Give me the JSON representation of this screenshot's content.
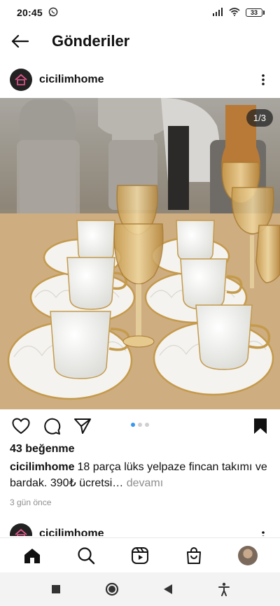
{
  "status_bar": {
    "time": "20:45",
    "battery": "33"
  },
  "header": {
    "title": "Gönderiler"
  },
  "post": {
    "username": "cicilimhome",
    "image_counter": "1/3",
    "carousel": {
      "count": 3,
      "active": 1
    },
    "likes": "43 beğenme",
    "caption_user": "cicilimhome",
    "caption_text": "18 parça lüks yelpaze fincan takımı ve bardak. 390₺ ücretsi",
    "caption_ellipsis": "…",
    "more_label": "devamı",
    "timestamp": "3 gün önce"
  },
  "next_post": {
    "username": "cicilimhome"
  },
  "bottom_nav": {
    "items": [
      "home-icon",
      "search-icon",
      "reels-icon",
      "shop-icon",
      "profile-avatar"
    ]
  },
  "colors": {
    "accent": "#3897f0",
    "text": "#111111",
    "muted": "#8e8e8e",
    "gold": "#c9a24a"
  }
}
